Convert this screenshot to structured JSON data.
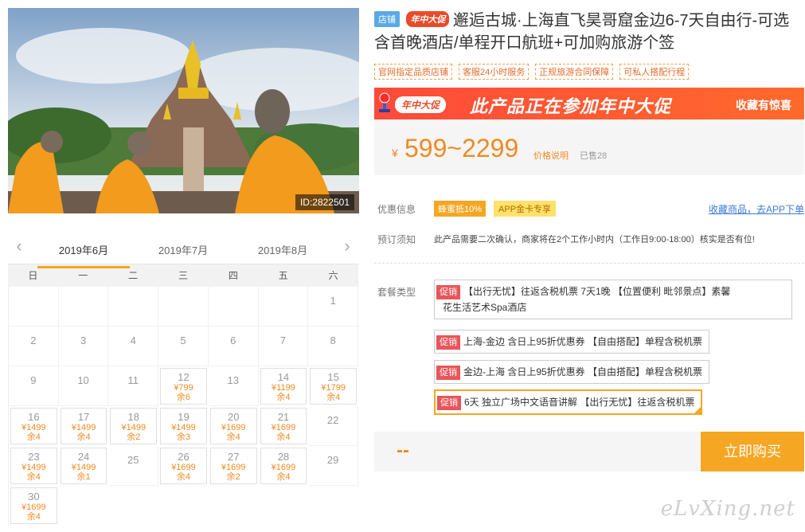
{
  "photo": {
    "id_label": "ID:2822501"
  },
  "calendar": {
    "months": [
      "2019年6月",
      "2019年7月",
      "2019年8月"
    ],
    "active_month": 0,
    "weekdays": [
      "日",
      "一",
      "二",
      "三",
      "四",
      "五",
      "六"
    ],
    "leading_blanks": 6,
    "days": [
      {
        "d": "1"
      },
      {
        "d": "2"
      },
      {
        "d": "3"
      },
      {
        "d": "4"
      },
      {
        "d": "5"
      },
      {
        "d": "6"
      },
      {
        "d": "7"
      },
      {
        "d": "8"
      },
      {
        "d": "9"
      },
      {
        "d": "10"
      },
      {
        "d": "11"
      },
      {
        "d": "12",
        "p": "¥799",
        "s": "余6"
      },
      {
        "d": "13"
      },
      {
        "d": "14",
        "p": "¥1199",
        "s": "余4"
      },
      {
        "d": "15",
        "p": "¥1799",
        "s": "余4"
      },
      {
        "d": "16",
        "p": "¥1499",
        "s": "余4"
      },
      {
        "d": "17",
        "p": "¥1499",
        "s": "余4"
      },
      {
        "d": "18",
        "p": "¥1499",
        "s": "余2"
      },
      {
        "d": "19",
        "p": "¥1499",
        "s": "余3"
      },
      {
        "d": "20",
        "p": "¥1699",
        "s": "余4"
      },
      {
        "d": "21",
        "p": "¥1699",
        "s": "余4"
      },
      {
        "d": "22"
      },
      {
        "d": "23",
        "p": "¥1499",
        "s": "余4"
      },
      {
        "d": "24",
        "p": "¥1499",
        "s": "余1"
      },
      {
        "d": "25"
      },
      {
        "d": "26",
        "p": "¥1699",
        "s": "余4"
      },
      {
        "d": "27",
        "p": "¥1699",
        "s": "余2"
      },
      {
        "d": "28",
        "p": "¥1699",
        "s": "余4"
      },
      {
        "d": "29"
      },
      {
        "d": "30",
        "p": "¥1699",
        "s": "余4"
      }
    ]
  },
  "product": {
    "badge_store": "店铺",
    "badge_promo": "年中大促",
    "title": "邂逅古城·上海直飞昊哥窟金边6-7天自由行-可选含首晚酒店/单程开口航班+可加购旅游个签",
    "tags": [
      "官网指定品质店铺",
      "客服24小时服务",
      "正规旅游合同保障",
      "可私人搭配行程"
    ]
  },
  "banner": {
    "logo": "年中大促",
    "headline": "此产品正在参加年中大促",
    "gift": "收藏有惊喜"
  },
  "price": {
    "currency": "¥",
    "range": "599~2299",
    "explain": "价格说明",
    "sold": "已售28"
  },
  "offers": {
    "label": "优惠信息",
    "items": [
      "蜂蜜抵10%",
      "APP金卡专享"
    ],
    "collect_link": "收藏商品，去APP下单"
  },
  "booking": {
    "label": "预订须知",
    "text": "此产品需要二次确认，商家将在2个工作小时内（工作日9:00-18:00）核实是否有位!"
  },
  "packages": {
    "label": "套餐类型",
    "tag": "促销",
    "items": [
      {
        "line1": "【出行无忧】往返含税机票 7天1晚 【位置便利 毗邻景点】素馨",
        "line2": "花生活艺术Spa酒店"
      },
      {
        "line1": "上海-金边 含日上95折优惠券 【自由搭配】单程含税机票",
        "line2": ""
      },
      {
        "line1": "金边-上海 含日上95折优惠券 【自由搭配】单程含税机票",
        "line2": ""
      },
      {
        "line1": "6天 独立广场中文语音讲解 【出行无忧】往返含税机票",
        "line2": ""
      }
    ],
    "selected": 3
  },
  "buy": {
    "total": "--",
    "button": "立即购买"
  },
  "watermark": "eLvXing.net",
  "colors": {
    "accent": "#f5a623",
    "price": "#f08a24",
    "promo": "#e84c2b",
    "link": "#3a7bd5"
  }
}
